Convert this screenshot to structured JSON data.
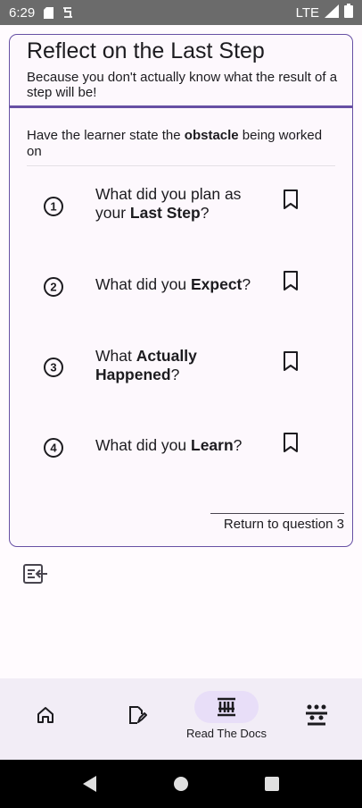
{
  "status_bar": {
    "time": "6:29",
    "network": "LTE"
  },
  "card": {
    "title": "Reflect on the Last Step",
    "subtitle": "Because you don't actually know what the result of a step will be!",
    "instruction": {
      "before": "Have the learner state the ",
      "bold": "obstacle",
      "after": " being worked on"
    }
  },
  "questions": [
    {
      "number": "1",
      "before": "What did you plan as your ",
      "bold": "Last Step",
      "after": "?"
    },
    {
      "number": "2",
      "before": "What did you ",
      "bold": "Expect",
      "after": "?"
    },
    {
      "number": "3",
      "before": "What ",
      "bold": "Actually Happened",
      "after": "?"
    },
    {
      "number": "4",
      "before": "What did you ",
      "bold": "Learn",
      "after": "?"
    }
  ],
  "return_link": "Return to question 3",
  "bottom_nav": {
    "items": [
      {
        "icon": "home-icon"
      },
      {
        "icon": "edit-note-icon"
      },
      {
        "icon": "read-the-docs-icon",
        "label": "Read The Docs",
        "active": true
      },
      {
        "icon": "groups-icon"
      }
    ]
  },
  "colors": {
    "accent": "#6750a4",
    "nav_pill": "#e8def8",
    "status_bar": "#6b6b6b"
  }
}
